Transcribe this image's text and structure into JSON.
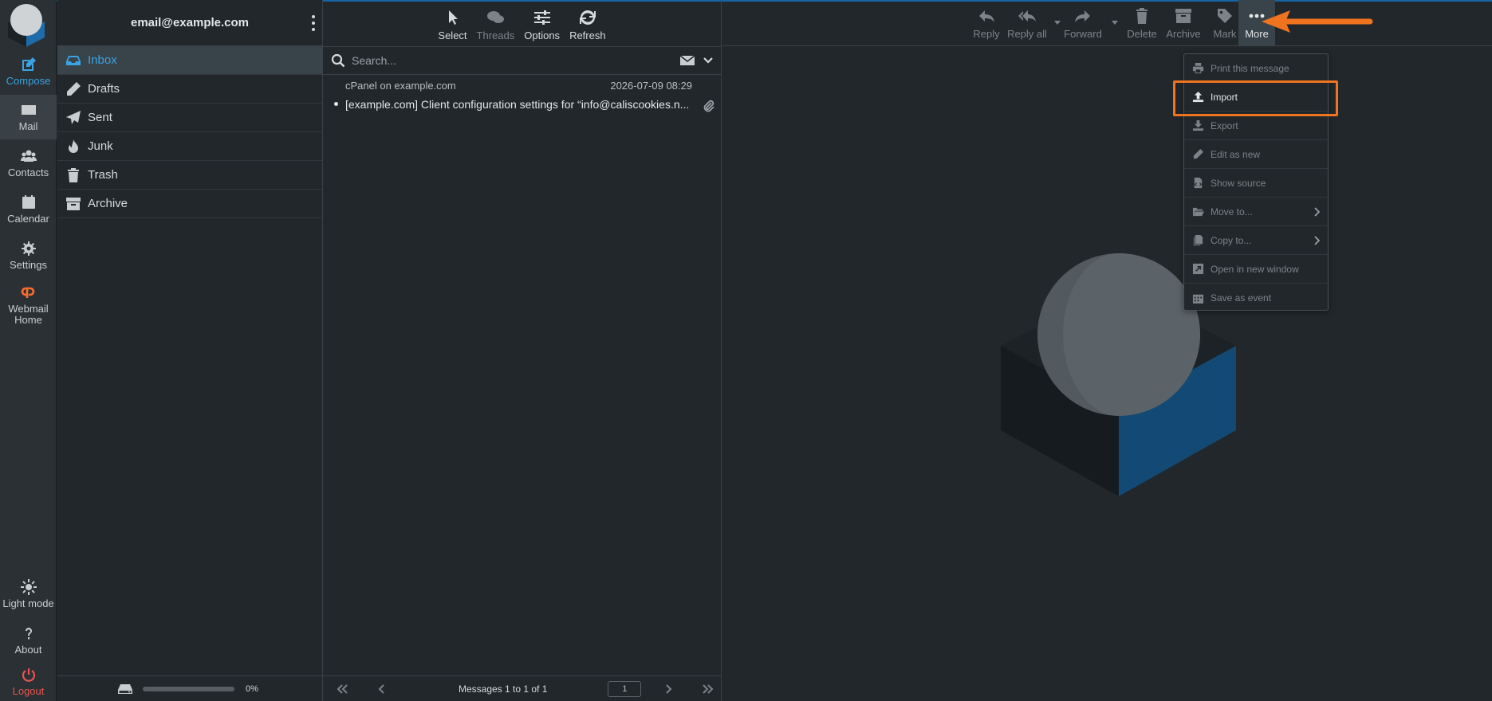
{
  "account": {
    "email": "email@example.com"
  },
  "taskbar": {
    "compose": "Compose",
    "mail": "Mail",
    "contacts": "Contacts",
    "calendar": "Calendar",
    "settings": "Settings",
    "webmail_home": "Webmail Home",
    "light_mode": "Light mode",
    "about": "About",
    "logout": "Logout"
  },
  "folders": [
    {
      "label": "Inbox",
      "icon": "inbox-icon",
      "selected": true
    },
    {
      "label": "Drafts",
      "icon": "pencil-icon"
    },
    {
      "label": "Sent",
      "icon": "paper-plane-icon"
    },
    {
      "label": "Junk",
      "icon": "fire-icon"
    },
    {
      "label": "Trash",
      "icon": "trash-icon"
    },
    {
      "label": "Archive",
      "icon": "archive-icon"
    }
  ],
  "quota": {
    "percent_label": "0%",
    "fraction": 0
  },
  "list_toolbar": {
    "select": "Select",
    "threads": "Threads",
    "options": "Options",
    "refresh": "Refresh"
  },
  "search": {
    "placeholder": "Search..."
  },
  "messages": [
    {
      "from": "cPanel on example.com",
      "date": "2026-07-09 08:29",
      "subject": "[example.com] Client configuration settings for “info@caliscookies.n..."
    }
  ],
  "list_footer": {
    "count_label": "Messages 1 to 1 of 1",
    "page": "1"
  },
  "message_toolbar": {
    "reply": "Reply",
    "reply_all": "Reply all",
    "forward": "Forward",
    "delete": "Delete",
    "archive": "Archive",
    "mark": "Mark",
    "more": "More"
  },
  "more_menu": [
    {
      "label": "Print this message",
      "icon": "printer-icon",
      "enabled": false
    },
    {
      "label": "Import",
      "icon": "upload-icon",
      "enabled": true
    },
    {
      "label": "Export",
      "icon": "download-icon",
      "enabled": false
    },
    {
      "label": "Edit as new",
      "icon": "pencil-icon",
      "enabled": false
    },
    {
      "label": "Show source",
      "icon": "file-code-icon",
      "enabled": false
    },
    {
      "label": "Move to...",
      "icon": "folder-open-icon",
      "enabled": false,
      "submenu": true
    },
    {
      "label": "Copy to...",
      "icon": "copy-icon",
      "enabled": false,
      "submenu": true
    },
    {
      "label": "Open in new window",
      "icon": "external-window-icon",
      "enabled": false
    },
    {
      "label": "Save as event",
      "icon": "calendar-icon",
      "enabled": false
    }
  ],
  "colors": {
    "accent": "#3aa3e3",
    "highlight": "#f0731f",
    "logout": "#e8554e",
    "background": "#22272b"
  }
}
